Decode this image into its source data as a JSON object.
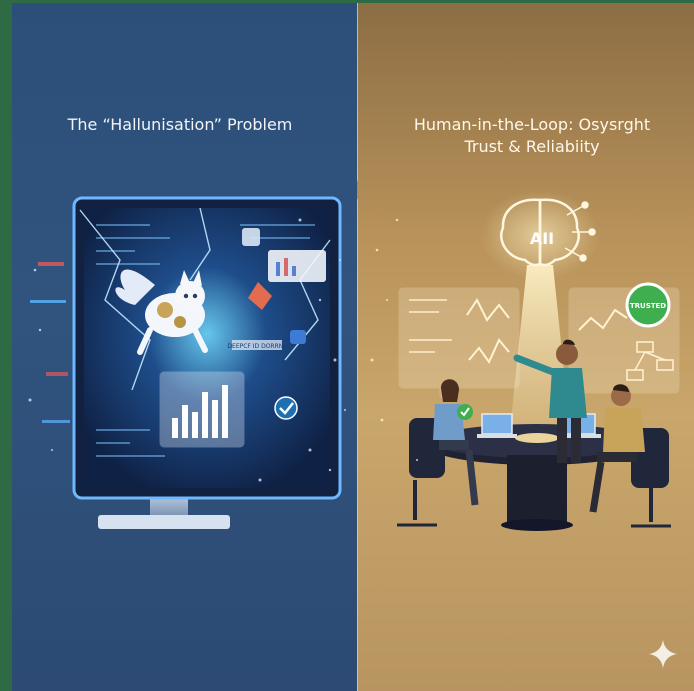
{
  "left": {
    "title": "The “Hallunisation” Problem",
    "screen_label": "DEEPCF ID DORRNL"
  },
  "right": {
    "title_line1": "Human-in-the-Loop: Osysrght",
    "title_line2": "Trust & Reliabiity",
    "brain_label": "AII",
    "badge_label": "TRUSTED"
  },
  "colors": {
    "left_bg": "#2c4f7a",
    "right_bg": "#c9a66b",
    "border_green": "#2e6b45",
    "trusted_green": "#3fae4f",
    "glow_blue": "#5fc8ff",
    "glow_gold": "#ffe7a6"
  },
  "icons": [
    "cat-icon",
    "brain-icon",
    "checkmark-icon",
    "sparkle-icon"
  ]
}
